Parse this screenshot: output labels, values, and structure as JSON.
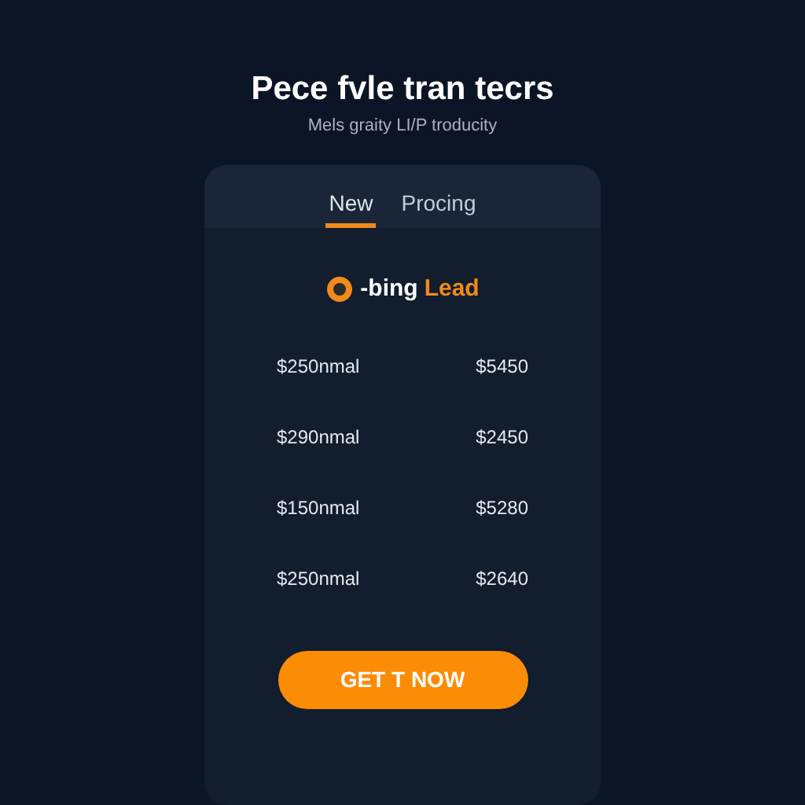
{
  "header": {
    "title": "Pece fvle tran tecrs",
    "subtitle": "Mels graity LI/P troducity"
  },
  "tabs": [
    {
      "label": "New",
      "selected": true
    },
    {
      "label": "Procing",
      "selected": false
    }
  ],
  "brand": {
    "prefix": "-bing",
    "suffix": "Lead"
  },
  "rows": [
    {
      "plan": "$250nmal",
      "price": "$5450"
    },
    {
      "plan": "$290nmal",
      "price": "$2450"
    },
    {
      "plan": "$150nmal",
      "price": "$5280"
    },
    {
      "plan": "$250nmal",
      "price": "$2640"
    }
  ],
  "cta": {
    "label": "GET T NOW"
  }
}
